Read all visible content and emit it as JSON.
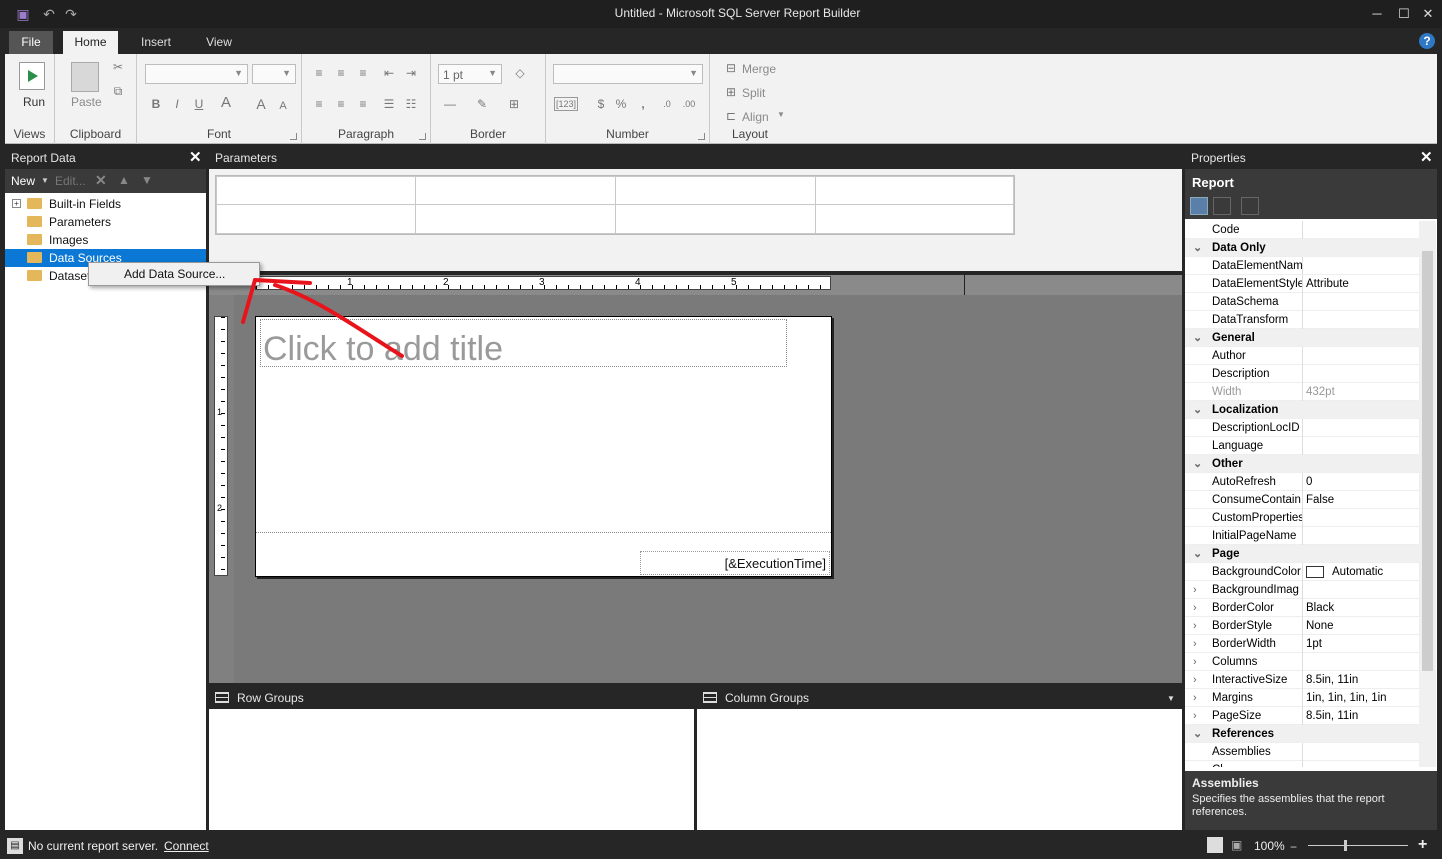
{
  "window": {
    "title": "Untitled - Microsoft SQL Server Report Builder"
  },
  "tabs": [
    {
      "label": "File"
    },
    {
      "label": "Home"
    },
    {
      "label": "Insert"
    },
    {
      "label": "View"
    }
  ],
  "ribbon": {
    "views": {
      "label": "Views",
      "run": "Run"
    },
    "clipboard": {
      "label": "Clipboard",
      "paste": "Paste"
    },
    "font": {
      "label": "Font",
      "bold": "B",
      "italic": "I",
      "underline": "U",
      "color": "A",
      "grow": "A",
      "shrink": "A"
    },
    "paragraph": {
      "label": "Paragraph"
    },
    "border": {
      "label": "Border",
      "width": "1 pt"
    },
    "number": {
      "label": "Number",
      "placeholder": "[123]",
      "currency": "$",
      "percent": "%",
      "comma": ","
    },
    "layout": {
      "label": "Layout",
      "merge": "Merge",
      "split": "Split",
      "align": "Align"
    }
  },
  "report_data": {
    "title": "Report Data",
    "toolbar": {
      "new": "New",
      "edit": "Edit..."
    },
    "items": [
      {
        "label": "Built-in Fields"
      },
      {
        "label": "Parameters"
      },
      {
        "label": "Images"
      },
      {
        "label": "Data Sources"
      },
      {
        "label": "Datasets"
      }
    ]
  },
  "context_menu": {
    "add_data_source": "Add Data Source..."
  },
  "parameters": {
    "title": "Parameters"
  },
  "design": {
    "ruler_h": [
      "1",
      "2",
      "3",
      "4",
      "5"
    ],
    "ruler_v": [
      "1",
      "2"
    ],
    "title_placeholder": "Click to add title",
    "execution_time": "[&ExecutionTime]"
  },
  "row_groups": {
    "title": "Row Groups"
  },
  "column_groups": {
    "title": "Column Groups"
  },
  "properties": {
    "title": "Properties",
    "object": "Report",
    "rows": [
      {
        "name": "Code",
        "value": "",
        "type": "prop"
      },
      {
        "name": "Data Only",
        "value": "",
        "type": "cat"
      },
      {
        "name": "DataElementNam",
        "value": "",
        "type": "prop"
      },
      {
        "name": "DataElementStyle",
        "value": "Attribute",
        "type": "prop"
      },
      {
        "name": "DataSchema",
        "value": "",
        "type": "prop"
      },
      {
        "name": "DataTransform",
        "value": "",
        "type": "prop"
      },
      {
        "name": "General",
        "value": "",
        "type": "cat"
      },
      {
        "name": "Author",
        "value": "",
        "type": "prop"
      },
      {
        "name": "Description",
        "value": "",
        "type": "prop"
      },
      {
        "name": "Width",
        "value": "432pt",
        "type": "dim"
      },
      {
        "name": "Localization",
        "value": "",
        "type": "cat"
      },
      {
        "name": "DescriptionLocID",
        "value": "",
        "type": "prop"
      },
      {
        "name": "Language",
        "value": "",
        "type": "prop"
      },
      {
        "name": "Other",
        "value": "",
        "type": "cat"
      },
      {
        "name": "AutoRefresh",
        "value": "0",
        "type": "prop"
      },
      {
        "name": "ConsumeContain",
        "value": "False",
        "type": "prop"
      },
      {
        "name": "CustomProperties",
        "value": "",
        "type": "prop"
      },
      {
        "name": "InitialPageName",
        "value": "",
        "type": "prop"
      },
      {
        "name": "Page",
        "value": "",
        "type": "cat"
      },
      {
        "name": "BackgroundColor",
        "value": "Automatic",
        "type": "color"
      },
      {
        "name": "BackgroundImag",
        "value": "",
        "type": "sub"
      },
      {
        "name": "BorderColor",
        "value": "Black",
        "type": "sub"
      },
      {
        "name": "BorderStyle",
        "value": "None",
        "type": "sub"
      },
      {
        "name": "BorderWidth",
        "value": "1pt",
        "type": "sub"
      },
      {
        "name": "Columns",
        "value": "",
        "type": "sub"
      },
      {
        "name": "InteractiveSize",
        "value": "8.5in, 11in",
        "type": "sub"
      },
      {
        "name": "Margins",
        "value": "1in, 1in, 1in, 1in",
        "type": "sub"
      },
      {
        "name": "PageSize",
        "value": "8.5in, 11in",
        "type": "sub"
      },
      {
        "name": "References",
        "value": "",
        "type": "cat"
      },
      {
        "name": "Assemblies",
        "value": "",
        "type": "prop"
      },
      {
        "name": "Cl",
        "value": "",
        "type": "prop"
      }
    ],
    "desc_title": "Assemblies",
    "desc_text": "Specifies the assemblies that the report references."
  },
  "status": {
    "server": "No current report server.",
    "connect": "Connect",
    "zoom": "100%"
  },
  "colors": {
    "accent": "#0a78d4",
    "annotation": "#e8141b"
  }
}
